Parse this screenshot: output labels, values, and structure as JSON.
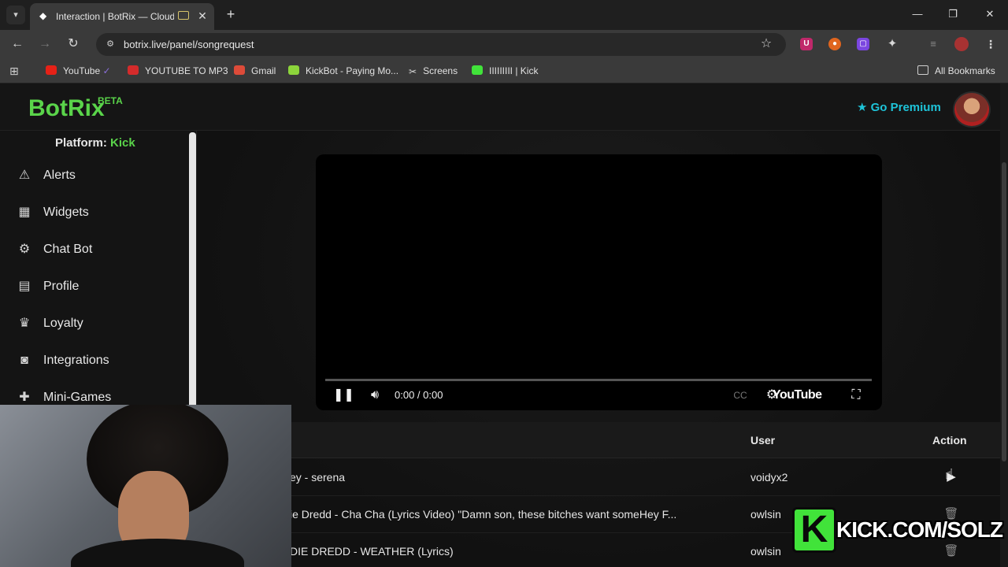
{
  "browser": {
    "tab_title": "Interaction | BotRix — Cloud",
    "url": "botrix.live/panel/songrequest",
    "bookmarks": [
      "YouTube",
      "YOUTUBE TO MP3",
      "Gmail",
      "KickBot - Paying Mo...",
      "Screens",
      "IIIIIIIII | Kick"
    ],
    "all_bookmarks": "All Bookmarks"
  },
  "app": {
    "logo": "BotRix",
    "beta": "BETA",
    "premium": "Go Premium",
    "platform_label": "Platform:",
    "platform_value": "Kick"
  },
  "sidebar": {
    "items": [
      {
        "label": "Alerts",
        "icon": "warning-icon"
      },
      {
        "label": "Widgets",
        "icon": "grid-icon"
      },
      {
        "label": "Chat Bot",
        "icon": "robot-icon"
      },
      {
        "label": "Profile",
        "icon": "id-card-icon"
      },
      {
        "label": "Loyalty",
        "icon": "trophy-icon"
      },
      {
        "label": "Integrations",
        "icon": "discord-icon"
      },
      {
        "label": "Mini-Games",
        "icon": "gamepad-icon"
      }
    ]
  },
  "player": {
    "time": "0:00 / 0:00",
    "brand": "YouTube"
  },
  "queue": {
    "headers": {
      "user": "User",
      "action": "Action"
    },
    "rows": [
      {
        "title": "ey - serena",
        "user": "voidyx2"
      },
      {
        "title": "ie Dredd - Cha Cha (Lyrics Video) \"Damn son, these bitches want someHey F...",
        "user": "owlsin"
      },
      {
        "title": "DIE DREDD - WEATHER (Lyrics)",
        "user": "owlsin"
      }
    ]
  },
  "overlay": {
    "kick_text": "KICK.COM/SOLZ",
    "kick_letter": "K"
  },
  "colors": {
    "brand_green": "#5ad44a",
    "premium_cyan": "#1ec3d8",
    "kick_green": "#41e33a"
  }
}
